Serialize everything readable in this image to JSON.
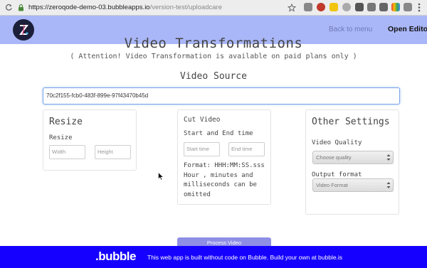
{
  "browser": {
    "url_host": "https://zeroqode-demo-03.bubbleapps.io",
    "url_path": "/version-test/uploadcare"
  },
  "header": {
    "logo_icon": "zeroqode-logo-icon",
    "back_label": "Back to menu",
    "editor_label": "Open Editor",
    "background": "#a9b6f7"
  },
  "main": {
    "title": "Video Transformations",
    "attention": "( Attention! Video Transformation is available on paid plans only )",
    "source_label": "Video Source",
    "source_value": "70c2f155-fcb0-483f-899e-97f43470b45d"
  },
  "resize": {
    "title": "Resize",
    "label": "Resize",
    "width_placeholder": "Width",
    "height_placeholder": "Height"
  },
  "cut": {
    "title": "Cut Video",
    "label": "Start and End time",
    "start_placeholder": "Start time",
    "end_placeholder": "End time",
    "format_text": "Format: HHH:MM:SS.sss Hour , minutes and milliseconds can be omitted"
  },
  "other": {
    "title": "Other Settings",
    "quality_label": "Video Quality",
    "quality_value": "Choose quality",
    "format_label": "Output format",
    "format_value": "Video Format"
  },
  "actions": {
    "process_label": "Process Video",
    "button_color": "#8f8ee6"
  },
  "banner": {
    "logo_text": ".bubble",
    "text": "This web app is built without code on Bubble. Build your own at bubble.is",
    "background": "#1500ff"
  }
}
